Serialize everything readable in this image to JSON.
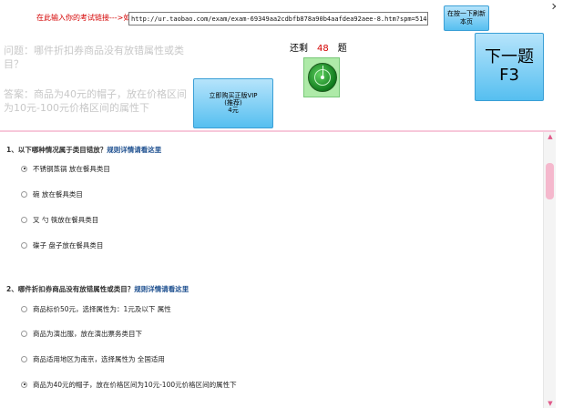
{
  "header": {
    "url_label": "在此输入你的考试链接--->如",
    "url_value": "http://ur.taobao.com/exam/exam-69349aa2cdbfb878a90b4aafdea92aee-8.htm?spm=5144.7072181",
    "refresh_button": "在按一下刷新本页",
    "close": "✕"
  },
  "question_panel": {
    "question_prefix": "问题：",
    "question": "哪件折扣券商品没有放错属性或类目？",
    "answer_prefix": "答案：",
    "answer": "商品为40元的帽子，放在价格区间为10元-100元价格区间的属性下"
  },
  "remaining": {
    "before": "还剩",
    "count": "48",
    "after": "题"
  },
  "vip_button": {
    "line1": "立即购买正版VIP",
    "line2": "(推荐)",
    "line3": "4元"
  },
  "next_button": {
    "line1": "下一题",
    "line2": "F3"
  },
  "questions": [
    {
      "title": "1、以下哪种情况属于类目错放？",
      "link": "规则详情请看这里",
      "options": [
        {
          "label": "不锈钢蒸锅 放在餐具类目",
          "checked": true
        },
        {
          "label": "碗 放在餐具类目",
          "checked": false
        },
        {
          "label": "叉 勺 筷放在餐具类目",
          "checked": false
        },
        {
          "label": "碟子 盘子放在餐具类目",
          "checked": false
        }
      ]
    },
    {
      "title": "2、哪件折扣券商品没有放错属性或类目？",
      "link": "规则详情请看这里",
      "options": [
        {
          "label": "商品标价50元，选择属性为：1元及以下 属性",
          "checked": false
        },
        {
          "label": "商品为演出服，放在演出票务类目下",
          "checked": false
        },
        {
          "label": "商品适用地区为南京，选择属性为 全国适用",
          "checked": false
        },
        {
          "label": "商品为40元的帽子，放在价格区间为10元-100元价格区间的属性下",
          "checked": true
        }
      ]
    }
  ],
  "scrollbar": {
    "up": "▲",
    "down": "▼"
  },
  "colors": {
    "accent_red": "#d40000",
    "button_blue": "#56bff0",
    "link_blue": "#1d4f8f",
    "scroll_pink": "#f5b8cd"
  }
}
